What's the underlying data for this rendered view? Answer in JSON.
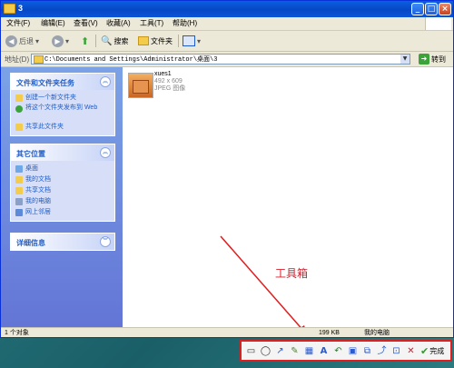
{
  "window": {
    "title": "3"
  },
  "menubar": {
    "items": [
      "文件(F)",
      "编辑(E)",
      "查看(V)",
      "收藏(A)",
      "工具(T)",
      "帮助(H)"
    ]
  },
  "toolbar": {
    "back": "后退",
    "search": "搜索",
    "folders": "文件夹"
  },
  "address": {
    "label": "地址(D)",
    "path": "C:\\Documents and Settings\\Administrator\\桌面\\3",
    "go": "转到"
  },
  "tasks_panel": {
    "title": "文件和文件夹任务",
    "items": [
      "创建一个新文件夹",
      "将这个文件夹发布到 Web",
      "共享此文件夹"
    ]
  },
  "other_places": {
    "title": "其它位置",
    "items": [
      "桌面",
      "我的文档",
      "共享文档",
      "我的电脑",
      "网上邻居"
    ]
  },
  "details_panel": {
    "title": "详细信息"
  },
  "file": {
    "name": "xues1",
    "dims": "492 x 609",
    "type": "JPEG 图像"
  },
  "status": {
    "count": "1 个对象",
    "size": "199 KB",
    "location": "我的电脑"
  },
  "annotation": {
    "text": "工具箱"
  },
  "screenshot_toolbar": {
    "done_label": "完成",
    "tools": [
      "rectangle-icon",
      "ellipse-icon",
      "arrow-icon",
      "pen-icon",
      "mosaic-icon",
      "text-icon",
      "undo-icon",
      "save-icon",
      "copy-icon",
      "share-icon",
      "pin-icon",
      "cancel-icon",
      "done-icon"
    ]
  },
  "colors": {
    "accent": "#215dc6",
    "highlight": "#e11d1d"
  }
}
